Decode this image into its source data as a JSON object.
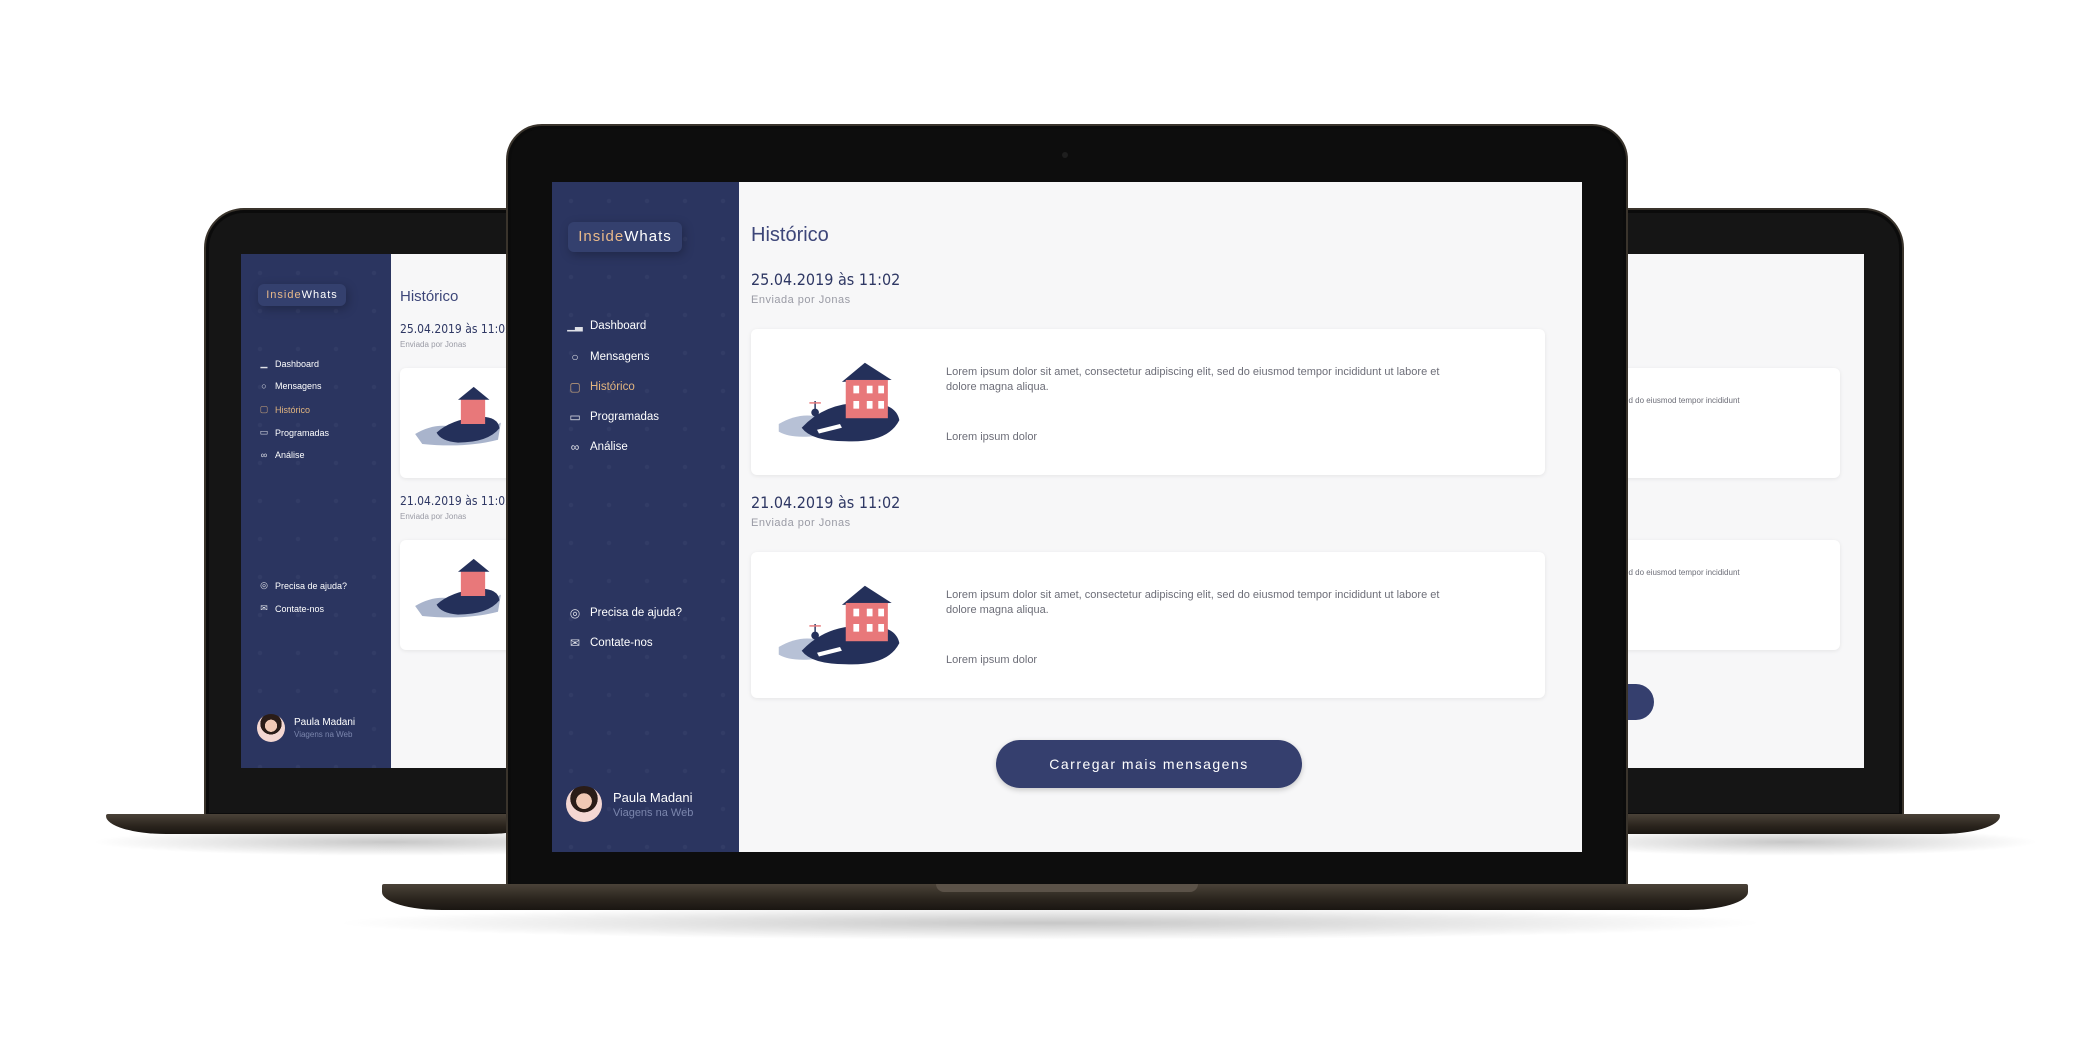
{
  "app": {
    "logo_part1": "Inside",
    "logo_part2": "Whats",
    "nav": [
      {
        "label": "Dashboard",
        "icon": "chart-icon"
      },
      {
        "label": "Mensagens",
        "icon": "chat-bubble-icon"
      },
      {
        "label": "Histórico",
        "icon": "history-icon",
        "active": true
      },
      {
        "label": "Programadas",
        "icon": "calendar-icon"
      },
      {
        "label": "Análise",
        "icon": "glasses-icon"
      }
    ],
    "help": [
      {
        "label": "Precisa de ajuda?",
        "icon": "lifebuoy-icon"
      },
      {
        "label": "Contate-nos",
        "icon": "mail-icon"
      }
    ],
    "user": {
      "name": "Paula Madani",
      "subtitle": "Viagens na Web"
    }
  },
  "page": {
    "title": "Histórico",
    "messages": [
      {
        "date": "25.04.2019 às 11:02",
        "sender": "Enviada por Jonas",
        "body": "Lorem ipsum dolor sit amet, consectetur adipiscing elit, sed do eiusmod tempor incididunt ut labore et dolore magna aliqua.",
        "footer": "Lorem ipsum dolor"
      },
      {
        "date": "21.04.2019 às 11:02",
        "sender": "Enviada por Jonas",
        "body": "Lorem ipsum dolor sit amet, consectetur adipiscing elit, sed do eiusmod tempor incididunt ut labore et dolore magna aliqua.",
        "footer": "Lorem ipsum dolor"
      }
    ],
    "load_more": "Carregar mais mensagens"
  },
  "back_right": {
    "snippet": "ed do eiusmod tempor incididunt"
  },
  "colors": {
    "sidebar": "#2b3560",
    "accent": "#e2b57f",
    "button": "#353f6e",
    "content_bg": "#f7f7f8"
  }
}
